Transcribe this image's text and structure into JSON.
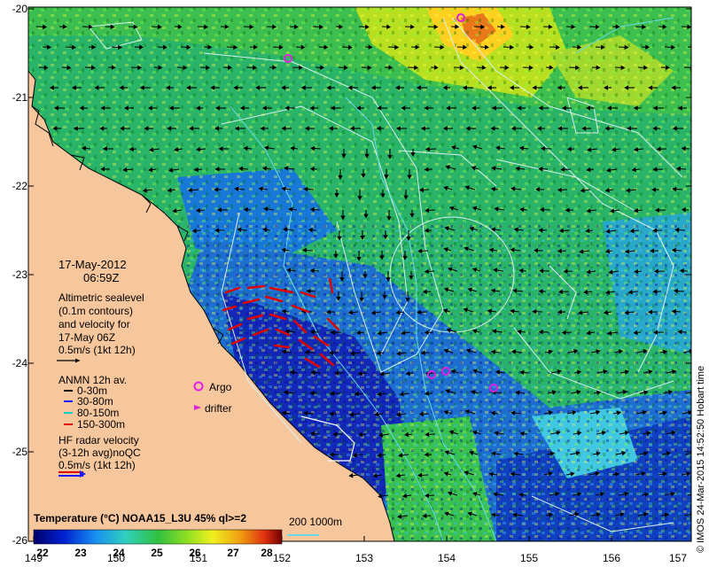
{
  "map": {
    "date": "17-May-2012",
    "time": "06:59Z",
    "lat_ticks": [
      "-20",
      "-21",
      "-22",
      "-23",
      "-24",
      "-25",
      "-26"
    ],
    "lon_ticks": [
      "149",
      "150",
      "151",
      "152",
      "153",
      "154",
      "155",
      "156",
      "157"
    ],
    "credit": "© IMOS 24-Mar-2015 14:52:50 Hobart time",
    "colors": {
      "land": "#f6c69c",
      "coast": "#000000",
      "contour": "#d8f0f0",
      "isobath": "#6ad8e8"
    }
  },
  "legend": {
    "altimetry": [
      "Altimetric sealevel",
      "(0.1m contours)",
      "and velocity for",
      "17-May 06Z"
    ],
    "scale_label": "0.5m/s (1kt 12h)",
    "anmn_title": "ANMN 12h av.",
    "anmn_items": [
      {
        "label": "0-30m",
        "color": "#000000"
      },
      {
        "label": "30-80m",
        "color": "#1a1aff"
      },
      {
        "label": "80-150m",
        "color": "#00d0d0"
      },
      {
        "label": "150-300m",
        "color": "#e00000"
      }
    ],
    "argo_label": "Argo",
    "drifter_label": "drifter",
    "hf_lines": [
      "HF radar velocity",
      "(3-12h avg)noQC",
      "0.5m/s (1kt 12h)"
    ],
    "markers": {
      "argo_color": "#e020e0",
      "drifter_color": "#e020e0",
      "hf_color": "#e00000"
    }
  },
  "colorbar": {
    "title": "Temperature (°C) NOAA15_L3U 45% ql>=2",
    "ticks": [
      "22",
      "23",
      "24",
      "25",
      "26",
      "27",
      "28"
    ],
    "isobath_label": "200  1000m"
  }
}
